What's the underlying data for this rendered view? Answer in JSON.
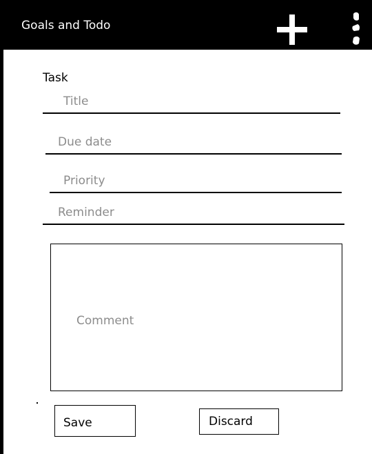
{
  "app_bar": {
    "title": "Goals and Todo",
    "add_icon": "plus-icon",
    "menu_icon": "more-vertical-icon",
    "background": "#000000",
    "foreground": "#ffffff"
  },
  "form": {
    "heading": "Task",
    "fields": {
      "title": {
        "placeholder": "Title",
        "value": ""
      },
      "due_date": {
        "placeholder": "Due date",
        "value": ""
      },
      "priority": {
        "placeholder": "Priority",
        "value": ""
      },
      "reminder": {
        "placeholder": "Reminder",
        "value": ""
      }
    },
    "comment": {
      "placeholder": "Comment",
      "value": ""
    },
    "placeholder_color": "#8c8c8c"
  },
  "actions": {
    "save_label": "Save",
    "discard_label": "Discard"
  }
}
